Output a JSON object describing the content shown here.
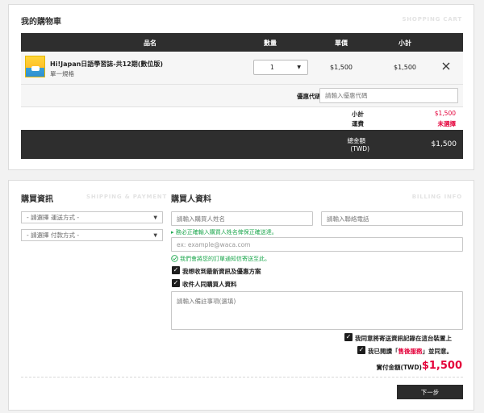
{
  "cart": {
    "title": "我的購物車",
    "ghost_title": "SHOPPING CART",
    "columns": {
      "name": "品名",
      "qty": "數量",
      "unit_price": "單價",
      "subtotal": "小計"
    },
    "item": {
      "name": "Hi!Japan日語學習誌-共12期(數位版)",
      "variant": "單一規格",
      "qty": "1",
      "unit_price": "$1,500",
      "subtotal": "$1,500",
      "remove_icon": "close-icon"
    },
    "coupon": {
      "label": "優惠代碼",
      "placeholder": "請輸入優惠代碼"
    },
    "summary": {
      "subtotal_label": "小計",
      "subtotal_value": "$1,500",
      "shipping_label": "運費",
      "shipping_value": "未選擇"
    },
    "total": {
      "label_line1": "總金額",
      "label_line2": "(TWD)",
      "value": "$1,500"
    }
  },
  "purchase": {
    "title": "購買資訊",
    "ghost_title": "SHIPPING & PAYMENT",
    "shipping_select": "- 請選擇 運送方式 -",
    "payment_select": "- 請選擇 付款方式 -"
  },
  "buyer": {
    "title": "購買人資料",
    "ghost_title": "BILLING INFO",
    "name_placeholder": "請輸入購買人姓名",
    "phone_placeholder": "請輸入聯絡電話",
    "name_hint": "▸ 務必正確輸入購買人姓名俾保正確送達。",
    "email_placeholder": "ex: example@waca.com",
    "email_hint": "我們會將您的訂單通知信寄送至此。",
    "newsletter_label": "我想收到最新資訊及優惠方案",
    "same_recipient_label": "收件人同購買人資料",
    "note_placeholder": "請輸入備註事項(選填)",
    "agree_store_label": "我同意將寄送資訊記錄在這台裝置上",
    "agree_terms_prefix": "我已閱讀「",
    "agree_terms_link": "售後服務",
    "agree_terms_suffix": "」並同意。",
    "pay_label": "實付金額(TWD)",
    "pay_value": "$1,500",
    "next_button": "下一步"
  },
  "colors": {
    "accent_red": "#e4003a",
    "dark_bar": "#2e2e2e",
    "hint_green": "#1fa84f"
  }
}
